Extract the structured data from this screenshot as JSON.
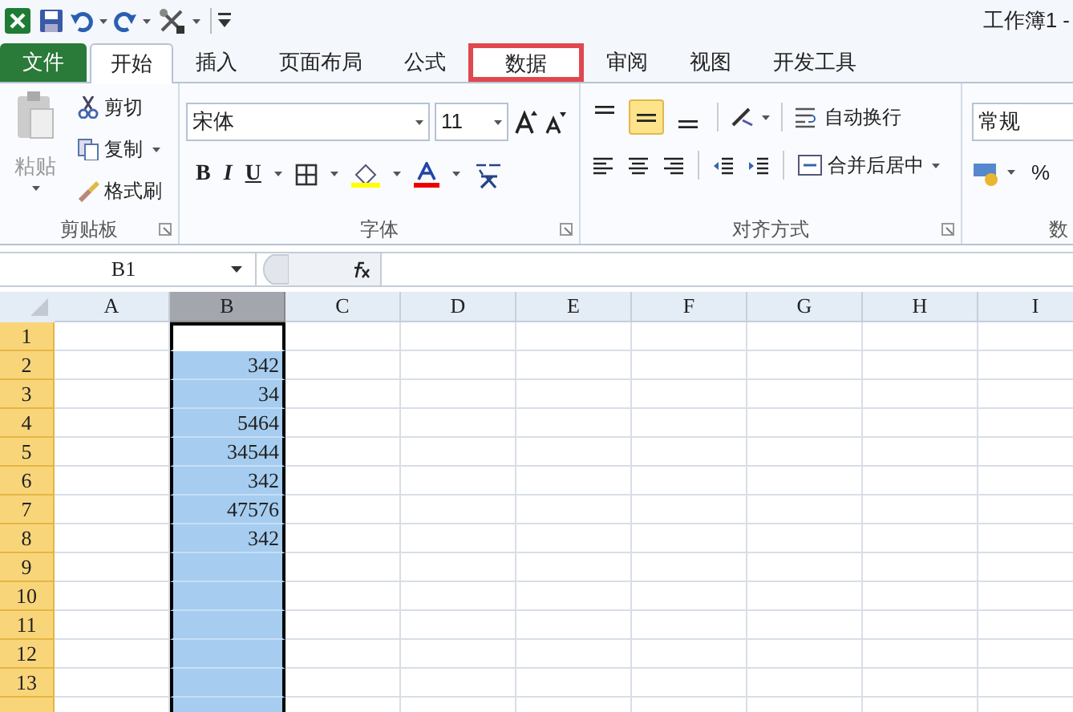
{
  "title_bar": {
    "title": "工作簿1 -"
  },
  "tabs": [
    {
      "label": "文件",
      "kind": "file",
      "selected": false,
      "highlighted": false
    },
    {
      "label": "开始",
      "kind": "tab",
      "selected": true,
      "highlighted": false
    },
    {
      "label": "插入",
      "kind": "tab",
      "selected": false,
      "highlighted": false
    },
    {
      "label": "页面布局",
      "kind": "tab",
      "selected": false,
      "highlighted": false
    },
    {
      "label": "公式",
      "kind": "tab",
      "selected": false,
      "highlighted": false
    },
    {
      "label": "数据",
      "kind": "tab",
      "selected": false,
      "highlighted": true
    },
    {
      "label": "审阅",
      "kind": "tab",
      "selected": false,
      "highlighted": false
    },
    {
      "label": "视图",
      "kind": "tab",
      "selected": false,
      "highlighted": false
    },
    {
      "label": "开发工具",
      "kind": "tab",
      "selected": false,
      "highlighted": false
    }
  ],
  "ribbon": {
    "clipboard": {
      "label": "剪贴板",
      "paste": "粘贴",
      "cut": "剪切",
      "copy": "复制",
      "format_painter": "格式刷"
    },
    "font": {
      "label": "字体",
      "font_name": "宋体",
      "font_size": "11",
      "bold": "B",
      "italic": "I",
      "underline": "U"
    },
    "alignment": {
      "label": "对齐方式",
      "vertical": [
        {
          "selected": false
        },
        {
          "selected": true
        },
        {
          "selected": false
        }
      ],
      "wrap_text": "自动换行",
      "merge_center": "合并后居中"
    },
    "number": {
      "label": "数",
      "format": "常规",
      "percent": "%"
    }
  },
  "formula_bar": {
    "name_box": "B1"
  },
  "sheet": {
    "columns": [
      {
        "label": "A",
        "selected": false
      },
      {
        "label": "B",
        "selected": true
      },
      {
        "label": "C",
        "selected": false
      },
      {
        "label": "D",
        "selected": false
      },
      {
        "label": "E",
        "selected": false
      },
      {
        "label": "F",
        "selected": false
      },
      {
        "label": "G",
        "selected": false
      },
      {
        "label": "H",
        "selected": false
      },
      {
        "label": "I",
        "selected": false
      }
    ],
    "rows": [
      {
        "header": "1",
        "selected": true,
        "active": true
      },
      {
        "header": "2",
        "selected": true,
        "active": false,
        "column_b": "342"
      },
      {
        "header": "3",
        "selected": true,
        "active": false,
        "column_b": "34"
      },
      {
        "header": "4",
        "selected": true,
        "active": false,
        "column_b": "5464"
      },
      {
        "header": "5",
        "selected": true,
        "active": false,
        "column_b": "34544"
      },
      {
        "header": "6",
        "selected": true,
        "active": false,
        "column_b": "342"
      },
      {
        "header": "7",
        "selected": true,
        "active": false,
        "column_b": "47576"
      },
      {
        "header": "8",
        "selected": true,
        "active": false,
        "column_b": "342"
      },
      {
        "header": "9",
        "selected": true,
        "active": false
      },
      {
        "header": "10",
        "selected": true,
        "active": false
      },
      {
        "header": "11",
        "selected": true,
        "active": false
      },
      {
        "header": "12",
        "selected": true,
        "active": false
      },
      {
        "header": "13",
        "selected": true,
        "active": false
      }
    ]
  }
}
